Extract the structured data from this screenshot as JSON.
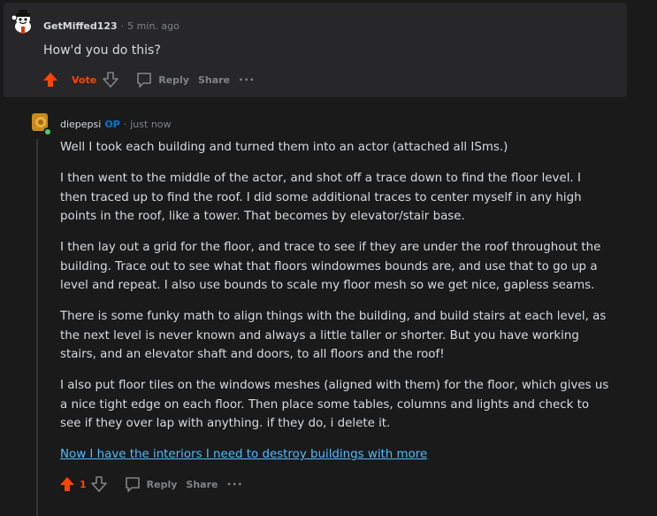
{
  "comment1": {
    "username": "GetMiffed123",
    "time": "5 min. ago",
    "text": "How'd you do this?",
    "actions": {
      "vote_label": "Vote",
      "reply_label": "Reply",
      "share_label": "Share",
      "more_label": "•••"
    }
  },
  "comment2": {
    "username": "diepepsi",
    "op_badge": "OP",
    "time": "just now",
    "paragraphs": [
      "Well I took each building and turned them into an actor (attached all ISms.)",
      "I then went to the middle of the actor, and shot off a trace down to find the floor level. I then traced up to find the roof. I did some additional traces to center myself in any high points in the roof, like a tower. That becomes by elevator/stair base.",
      "I then lay out a grid for the floor, and trace to see if they are under the roof throughout the building. Trace out to see what that floors windowmes bounds are, and use that to go up a level and repeat. I also use bounds to scale my floor mesh so we get nice, gapless seams.",
      "There is some funky math to align things with the building, and build stairs at each level, as the next level is never known and always a little taller or shorter. But you have working stairs, and an elevator shaft and doors, to all floors and the roof!",
      "I also put floor tiles on the windows meshes (aligned with them) for the floor, which gives us a nice tight edge on each floor. Then place some tables, columns and lights and check to see if they over lap with anything. if they do, i delete it."
    ],
    "link_text": "Now I have the interiors I need to destroy buildings with more",
    "actions": {
      "vote_count": "1",
      "reply_label": "Reply",
      "share_label": "Share",
      "more_label": "•••"
    }
  },
  "colors": {
    "background": "#1a1a1b",
    "card": "#272729",
    "upvote": "#ff4500",
    "link": "#4fbcff",
    "op": "#0079d3",
    "muted": "#818384"
  }
}
